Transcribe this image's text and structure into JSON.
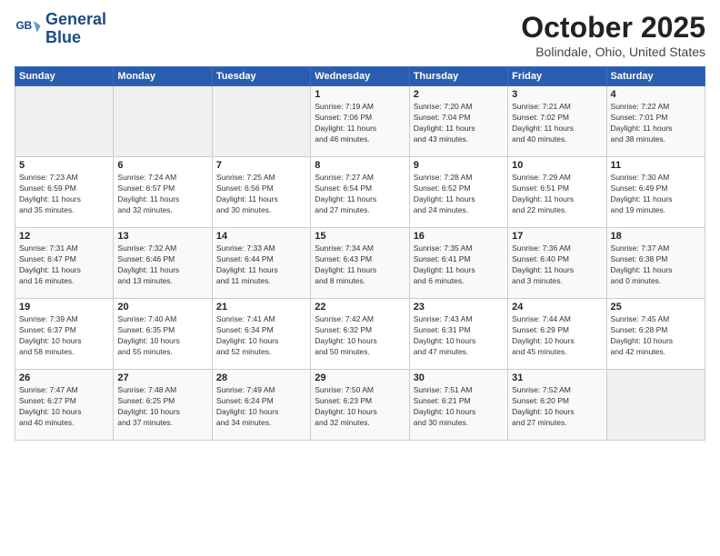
{
  "logo": {
    "line1": "General",
    "line2": "Blue"
  },
  "title": "October 2025",
  "location": "Bolindale, Ohio, United States",
  "days_of_week": [
    "Sunday",
    "Monday",
    "Tuesday",
    "Wednesday",
    "Thursday",
    "Friday",
    "Saturday"
  ],
  "weeks": [
    [
      {
        "day": "",
        "info": ""
      },
      {
        "day": "",
        "info": ""
      },
      {
        "day": "",
        "info": ""
      },
      {
        "day": "1",
        "info": "Sunrise: 7:19 AM\nSunset: 7:06 PM\nDaylight: 11 hours\nand 46 minutes."
      },
      {
        "day": "2",
        "info": "Sunrise: 7:20 AM\nSunset: 7:04 PM\nDaylight: 11 hours\nand 43 minutes."
      },
      {
        "day": "3",
        "info": "Sunrise: 7:21 AM\nSunset: 7:02 PM\nDaylight: 11 hours\nand 40 minutes."
      },
      {
        "day": "4",
        "info": "Sunrise: 7:22 AM\nSunset: 7:01 PM\nDaylight: 11 hours\nand 38 minutes."
      }
    ],
    [
      {
        "day": "5",
        "info": "Sunrise: 7:23 AM\nSunset: 6:59 PM\nDaylight: 11 hours\nand 35 minutes."
      },
      {
        "day": "6",
        "info": "Sunrise: 7:24 AM\nSunset: 6:57 PM\nDaylight: 11 hours\nand 32 minutes."
      },
      {
        "day": "7",
        "info": "Sunrise: 7:25 AM\nSunset: 6:56 PM\nDaylight: 11 hours\nand 30 minutes."
      },
      {
        "day": "8",
        "info": "Sunrise: 7:27 AM\nSunset: 6:54 PM\nDaylight: 11 hours\nand 27 minutes."
      },
      {
        "day": "9",
        "info": "Sunrise: 7:28 AM\nSunset: 6:52 PM\nDaylight: 11 hours\nand 24 minutes."
      },
      {
        "day": "10",
        "info": "Sunrise: 7:29 AM\nSunset: 6:51 PM\nDaylight: 11 hours\nand 22 minutes."
      },
      {
        "day": "11",
        "info": "Sunrise: 7:30 AM\nSunset: 6:49 PM\nDaylight: 11 hours\nand 19 minutes."
      }
    ],
    [
      {
        "day": "12",
        "info": "Sunrise: 7:31 AM\nSunset: 6:47 PM\nDaylight: 11 hours\nand 16 minutes."
      },
      {
        "day": "13",
        "info": "Sunrise: 7:32 AM\nSunset: 6:46 PM\nDaylight: 11 hours\nand 13 minutes."
      },
      {
        "day": "14",
        "info": "Sunrise: 7:33 AM\nSunset: 6:44 PM\nDaylight: 11 hours\nand 11 minutes."
      },
      {
        "day": "15",
        "info": "Sunrise: 7:34 AM\nSunset: 6:43 PM\nDaylight: 11 hours\nand 8 minutes."
      },
      {
        "day": "16",
        "info": "Sunrise: 7:35 AM\nSunset: 6:41 PM\nDaylight: 11 hours\nand 6 minutes."
      },
      {
        "day": "17",
        "info": "Sunrise: 7:36 AM\nSunset: 6:40 PM\nDaylight: 11 hours\nand 3 minutes."
      },
      {
        "day": "18",
        "info": "Sunrise: 7:37 AM\nSunset: 6:38 PM\nDaylight: 11 hours\nand 0 minutes."
      }
    ],
    [
      {
        "day": "19",
        "info": "Sunrise: 7:39 AM\nSunset: 6:37 PM\nDaylight: 10 hours\nand 58 minutes."
      },
      {
        "day": "20",
        "info": "Sunrise: 7:40 AM\nSunset: 6:35 PM\nDaylight: 10 hours\nand 55 minutes."
      },
      {
        "day": "21",
        "info": "Sunrise: 7:41 AM\nSunset: 6:34 PM\nDaylight: 10 hours\nand 52 minutes."
      },
      {
        "day": "22",
        "info": "Sunrise: 7:42 AM\nSunset: 6:32 PM\nDaylight: 10 hours\nand 50 minutes."
      },
      {
        "day": "23",
        "info": "Sunrise: 7:43 AM\nSunset: 6:31 PM\nDaylight: 10 hours\nand 47 minutes."
      },
      {
        "day": "24",
        "info": "Sunrise: 7:44 AM\nSunset: 6:29 PM\nDaylight: 10 hours\nand 45 minutes."
      },
      {
        "day": "25",
        "info": "Sunrise: 7:45 AM\nSunset: 6:28 PM\nDaylight: 10 hours\nand 42 minutes."
      }
    ],
    [
      {
        "day": "26",
        "info": "Sunrise: 7:47 AM\nSunset: 6:27 PM\nDaylight: 10 hours\nand 40 minutes."
      },
      {
        "day": "27",
        "info": "Sunrise: 7:48 AM\nSunset: 6:25 PM\nDaylight: 10 hours\nand 37 minutes."
      },
      {
        "day": "28",
        "info": "Sunrise: 7:49 AM\nSunset: 6:24 PM\nDaylight: 10 hours\nand 34 minutes."
      },
      {
        "day": "29",
        "info": "Sunrise: 7:50 AM\nSunset: 6:23 PM\nDaylight: 10 hours\nand 32 minutes."
      },
      {
        "day": "30",
        "info": "Sunrise: 7:51 AM\nSunset: 6:21 PM\nDaylight: 10 hours\nand 30 minutes."
      },
      {
        "day": "31",
        "info": "Sunrise: 7:52 AM\nSunset: 6:20 PM\nDaylight: 10 hours\nand 27 minutes."
      },
      {
        "day": "",
        "info": ""
      }
    ]
  ]
}
